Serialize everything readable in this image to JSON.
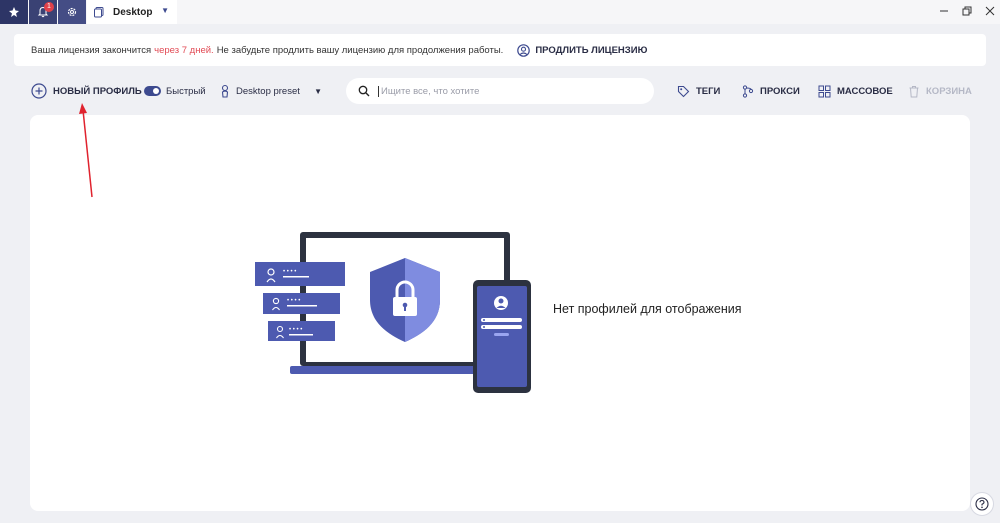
{
  "titlebar": {
    "notification_count": "1",
    "tab_label": "Desktop"
  },
  "banner": {
    "text_before": "Ваша лицензия закончится",
    "warn_text": "через 7 дней.",
    "text_after": "Не забудьте продлить вашу лицензию для продолжения работы.",
    "renew_label": "ПРОДЛИТЬ ЛИЦЕНЗИЮ"
  },
  "toolbar": {
    "new_profile_label": "НОВЫЙ ПРОФИЛЬ",
    "quick_label": "Быстрый",
    "preset_label": "Desktop preset",
    "search_placeholder": "Ищите все, что хотите",
    "tags_label": "ТЕГИ",
    "proxy_label": "ПРОКСИ",
    "bulk_label": "МАССОВОЕ",
    "trash_label": "КОРЗИНА"
  },
  "main": {
    "empty_message": "Нет профилей для отображения"
  },
  "colors": {
    "accent": "#3d4a8f",
    "warning": "#e24b55",
    "annotation_arrow": "#e0232e"
  }
}
